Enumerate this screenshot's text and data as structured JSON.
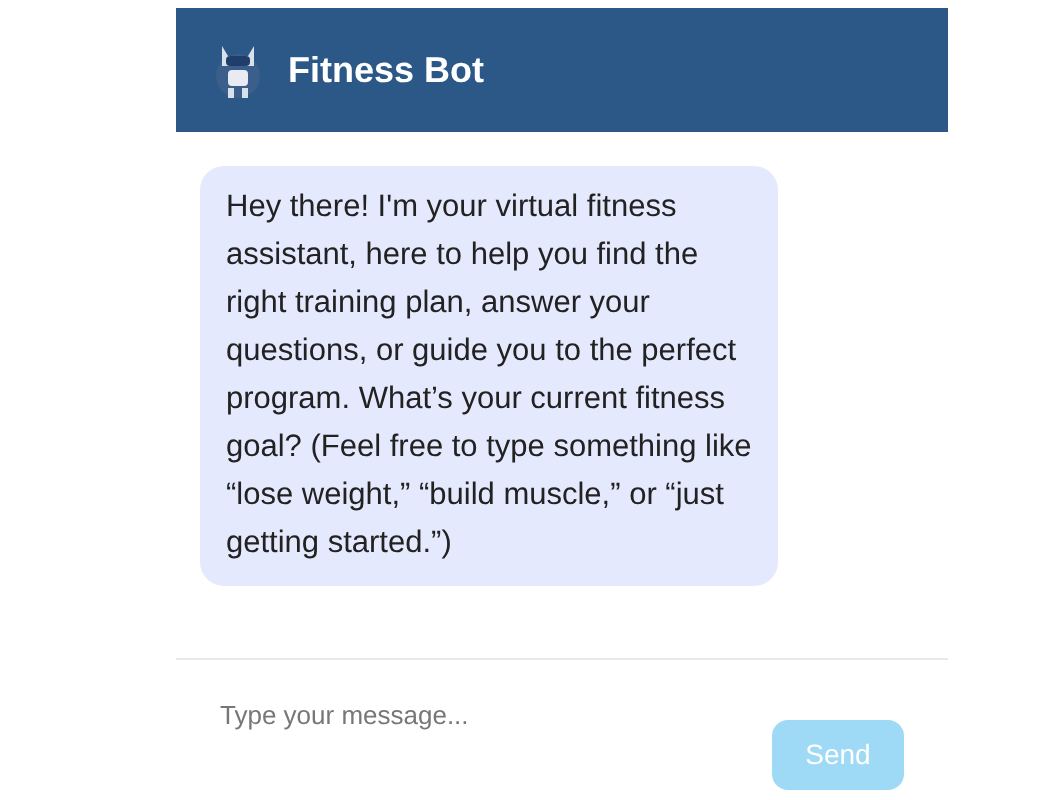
{
  "header": {
    "title": "Fitness Bot"
  },
  "messages": [
    {
      "kind": "bot",
      "text": "Hey there! I'm your virtual fitness assistant, here to help you find the right training plan, answer your questions, or guide you to the perfect program. What’s your current fitness goal? (Feel free to type something like “lose weight,” “build muscle,” or “just getting started.”)"
    }
  ],
  "composer": {
    "placeholder": "Type your message...",
    "send": {
      "label": "Send",
      "disabled": true
    }
  }
}
